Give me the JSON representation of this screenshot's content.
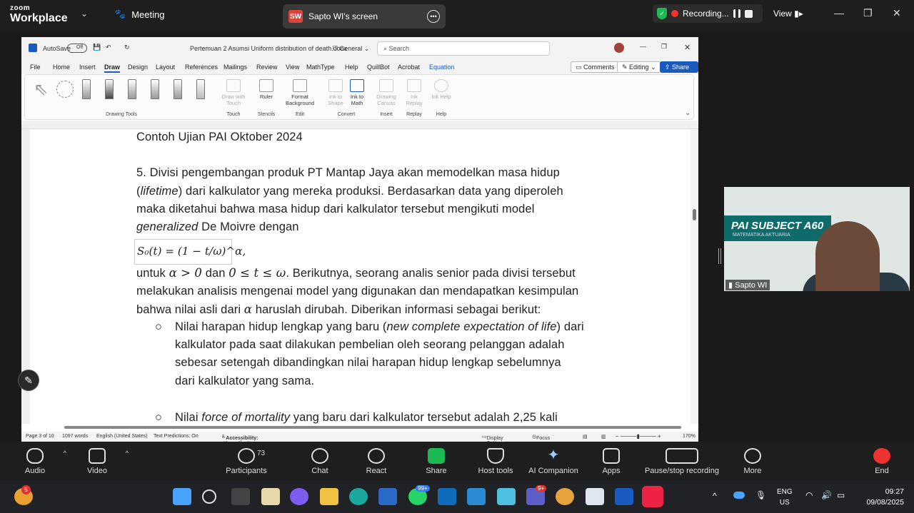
{
  "zoom": {
    "logo_top": "zoom",
    "logo_bottom": "Workplace",
    "meeting_label": "Meeting",
    "share_initials": "SW",
    "share_title": "Sapto WI's screen",
    "recording_label": "Recording...",
    "view_label": "View"
  },
  "word": {
    "autosave": "AutoSave",
    "autosave_state": "Off",
    "filename": "Pertemuan 2 Asumsi Uniform distribution of death.docx",
    "sensitivity": "General",
    "search_placeholder": "Search",
    "menu": [
      "File",
      "Home",
      "Insert",
      "Draw",
      "Design",
      "Layout",
      "References",
      "Mailings",
      "Review",
      "View",
      "MathType",
      "Help",
      "QuillBot",
      "Acrobat",
      "Equation"
    ],
    "comments": "Comments",
    "editing": "Editing",
    "share": "Share",
    "ribbon": {
      "drawing_tools": "Drawing Tools",
      "draw_with_touch": "Draw with Touch",
      "touch": "Touch",
      "ruler": "Ruler",
      "stencils": "Stencils",
      "format_background": "Format Background",
      "edit": "Edit",
      "ink_to_shape": "Ink to Shape",
      "ink_to_math": "Ink to Math",
      "convert": "Convert",
      "drawing_canvas": "Drawing Canvas",
      "insert": "Insert",
      "ink_replay": "Ink Replay",
      "replay": "Replay",
      "ink_help": "Ink Help",
      "help": "Help"
    },
    "doc": {
      "heading": "Contoh Ujian PAI Oktober 2024",
      "p1": "5. Divisi pengembangan produk PT Mantap Jaya akan memodelkan masa hidup",
      "p2_open": "(",
      "p2_italic": "lifetime",
      "p2_rest": ") dari kalkulator yang mereka produksi. Berdasarkan data yang diperoleh",
      "p3": "maka diketahui bahwa masa hidup dari kalkulator tersebut mengikuti model",
      "p4_italic": "generalized",
      "p4_rest": " De Moivre dengan",
      "equation": "S₀(t) = (1 − t/ω)^α,",
      "p5_a": "untuk ",
      "p5_m1": "α > 0",
      "p5_b": " dan ",
      "p5_m2": "0 ≤ t ≤ ω",
      "p5_c": ". Berikutnya, seorang analis senior pada divisi tersebut",
      "p6": "melakukan analisis mengenai model yang digunakan dan mendapatkan kesimpulan",
      "p7_a": "bahwa nilai asli dari ",
      "p7_m": "α",
      "p7_b": " haruslah dirubah. Diberikan informasi sebagai berikut:",
      "b1_a": "Nilai harapan hidup lengkap yang baru (",
      "b1_i": "new complete expectation of life",
      "b1_b": ") dari",
      "b1_l2": "kalkulator pada saat dilakukan pembelian oleh seorang pelanggan adalah",
      "b1_l3": "sebesar setengah dibandingkan nilai harapan hidup lengkap sebelumnya",
      "b1_l4": "dari kalkulator yang sama.",
      "b2_a": "Nilai ",
      "b2_i": "force of mortality",
      "b2_b": " yang baru dari kalkulator tersebut adalah 2,25 kali",
      "bullet": "○"
    },
    "status": {
      "page": "Page 3 of 10",
      "words": "1097 words",
      "lang": "English (United States)",
      "predictions": "Text Predictions: On",
      "accessibility": "Accessibility: Investigate",
      "display": "Display Settings",
      "focus": "Focus",
      "zoom": "170%"
    }
  },
  "video": {
    "subject": "PAI SUBJECT A60",
    "subtitle": "MATEMATIKA AKTUARIA",
    "participant": "Sapto WI"
  },
  "toolbar": {
    "audio": "Audio",
    "video": "Video",
    "participants": "Participants",
    "participants_count": "73",
    "chat": "Chat",
    "react": "React",
    "share": "Share",
    "host_tools": "Host tools",
    "ai_companion": "AI Companion",
    "apps": "Apps",
    "pause_recording": "Pause/stop recording",
    "more": "More",
    "end": "End"
  },
  "taskbar": {
    "lang_top": "ENG",
    "lang_bottom": "US",
    "time": "09:27",
    "date": "09/08/2025",
    "badge_widgets": "5",
    "badge_whatsapp": "99+",
    "badge_teams": "9+"
  },
  "colors": {
    "zoom_bg": "#1e1e1e",
    "word_accent": "#185abd",
    "share_green": "#1db954",
    "end_red": "#e33333"
  }
}
